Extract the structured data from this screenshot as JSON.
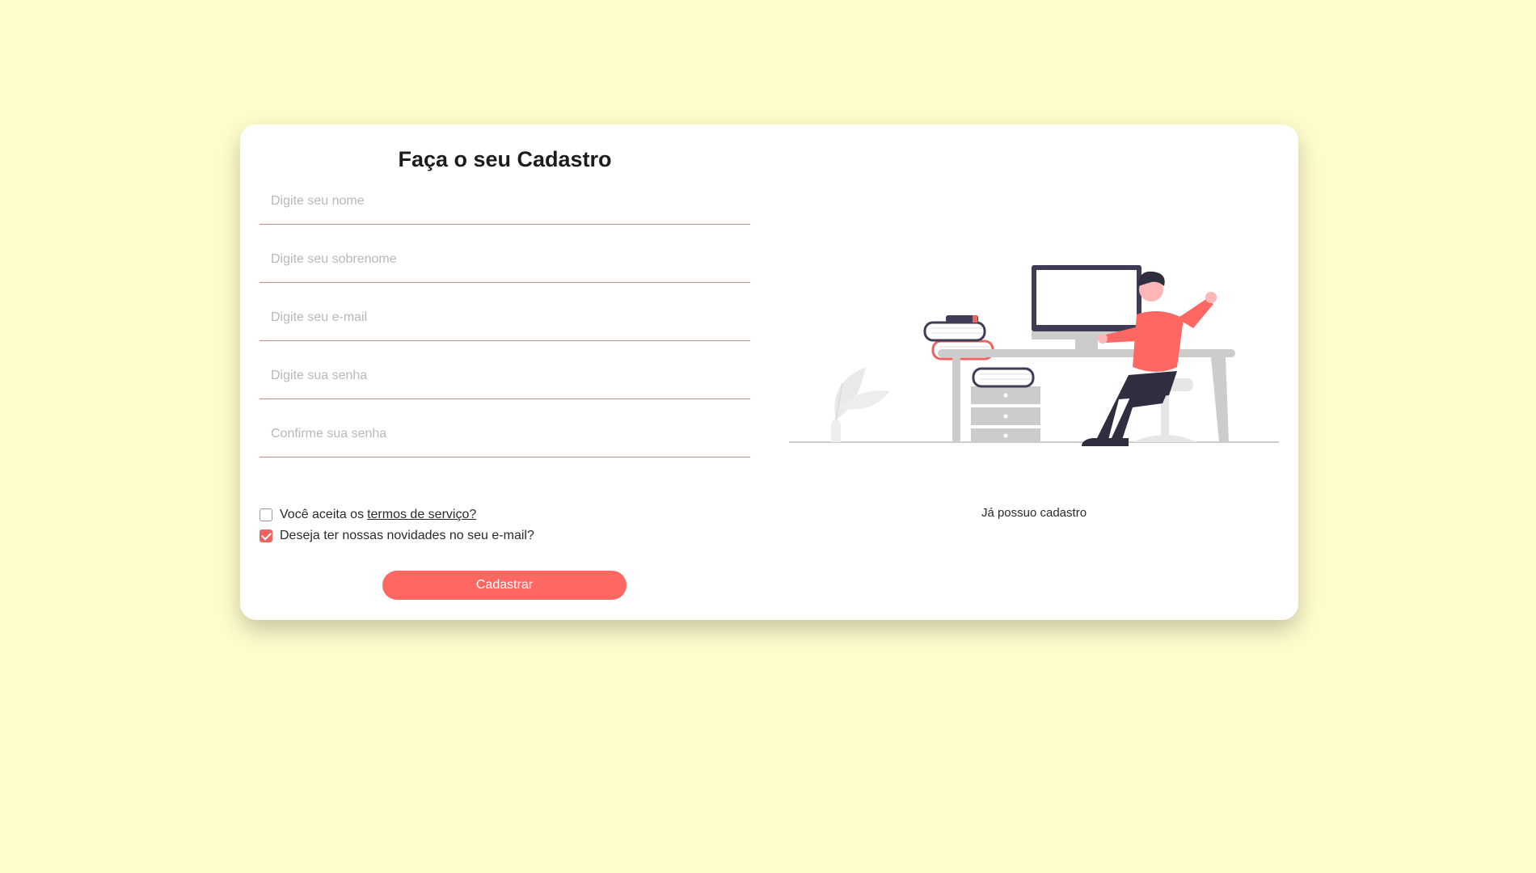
{
  "form": {
    "title": "Faça o seu Cadastro",
    "fields": [
      {
        "name": "nome",
        "placeholder": "Digite seu nome",
        "value": ""
      },
      {
        "name": "sobrenome",
        "placeholder": "Digite seu sobrenome",
        "value": ""
      },
      {
        "name": "email",
        "placeholder": "Digite seu e-mail",
        "value": ""
      },
      {
        "name": "senha",
        "placeholder": "Digite sua senha",
        "value": ""
      },
      {
        "name": "confirmar",
        "placeholder": "Confirme sua senha",
        "value": ""
      }
    ],
    "terms": {
      "prefix": "Você aceita os",
      "link": "termos de serviço?",
      "checked": false
    },
    "newsletter": {
      "label": "Deseja ter nossas novidades no seu e-mail?",
      "checked": true
    },
    "submit_label": "Cadastrar"
  },
  "side": {
    "illustration": "person-at-desk-illustration",
    "login_link": "Já possuo cadastro"
  },
  "colors": {
    "background": "#fffccc",
    "accent": "#ff6763",
    "field_underline": "#c98a86"
  }
}
